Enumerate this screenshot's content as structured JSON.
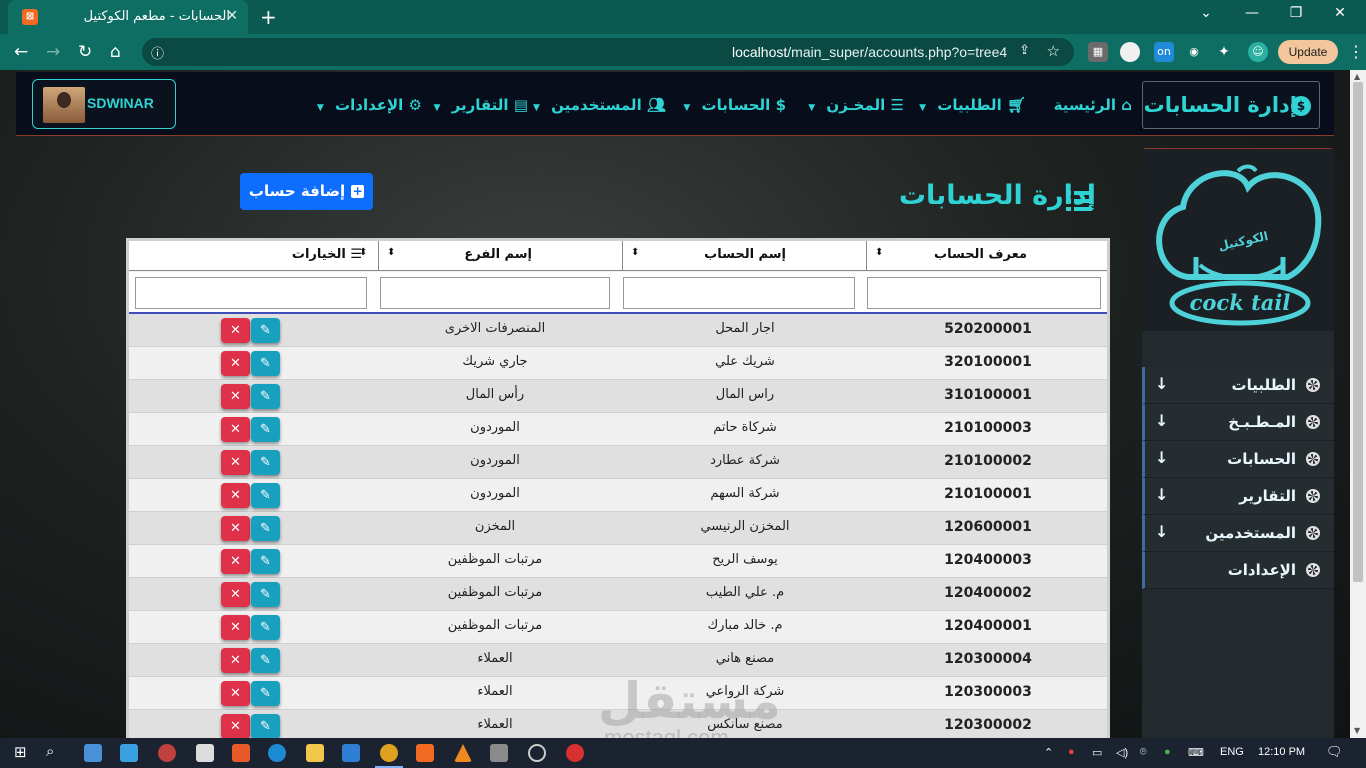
{
  "browser": {
    "tab_title": "الحسابات - مطعم الكوكتيل",
    "tab_close": "✕",
    "new_tab": "+",
    "url_host": "localhost",
    "url_path": "/main_super/accounts.php?o=tree4",
    "update_label": "Update",
    "window_controls": [
      "⌄",
      "—",
      "❐",
      "✕"
    ]
  },
  "navbar": {
    "brand_title": "إدارة الحسابات",
    "brand_icon": "$",
    "items": [
      {
        "label": "الرئيسية",
        "icon": "home-icon",
        "has_caret": false
      },
      {
        "label": "الطلبيات",
        "icon": "cart-icon",
        "has_caret": true
      },
      {
        "label": "المخـزن",
        "icon": "database-icon",
        "has_caret": true
      },
      {
        "label": "الحسابات",
        "icon": "money-icon",
        "has_caret": true
      },
      {
        "label": "المستخدمين",
        "icon": "users-icon",
        "has_caret": true
      },
      {
        "label": "التقارير",
        "icon": "chart-icon",
        "has_caret": true
      },
      {
        "label": "الإعدادات",
        "icon": "gear-icon",
        "has_caret": true
      }
    ],
    "username": "SDWINAR"
  },
  "sidebar": {
    "logo_text": "cock tail",
    "logo_arabic": "الكوكتيل",
    "items": [
      {
        "label": "الطلبيات",
        "has_arrow": true
      },
      {
        "label": "المـطـبـخ",
        "has_arrow": true
      },
      {
        "label": "الحسابات",
        "has_arrow": true
      },
      {
        "label": "التقارير",
        "has_arrow": true
      },
      {
        "label": "المستخدمين",
        "has_arrow": true
      },
      {
        "label": "الإعدادات",
        "has_arrow": false
      }
    ]
  },
  "main": {
    "page_title": "إدارة الحسابات",
    "add_button": "إضافة حساب",
    "table": {
      "headers": [
        "معرف الحساب",
        "إسم الحساب",
        "إسم الفرع",
        "الخيارات"
      ],
      "rows": [
        {
          "id": "520200001",
          "name": "اجار المحل",
          "branch": "المنصرفات الاخرى"
        },
        {
          "id": "320100001",
          "name": "شريك علي",
          "branch": "جاري شريك"
        },
        {
          "id": "310100001",
          "name": "راس المال",
          "branch": "رأس المال"
        },
        {
          "id": "210100003",
          "name": "شركاة حاتم",
          "branch": "الموردون"
        },
        {
          "id": "210100002",
          "name": "شركة عطارد",
          "branch": "الموردون"
        },
        {
          "id": "210100001",
          "name": "شركة السهم",
          "branch": "الموردون"
        },
        {
          "id": "120600001",
          "name": "المخزن الرنيسي",
          "branch": "المخزن"
        },
        {
          "id": "120400003",
          "name": "يوسف الريح",
          "branch": "مرتبات الموظفين"
        },
        {
          "id": "120400002",
          "name": "م. علي الطيب",
          "branch": "مرتبات الموظفين"
        },
        {
          "id": "120400001",
          "name": "م. خالد مبارك",
          "branch": "مرتبات الموظفين"
        },
        {
          "id": "120300004",
          "name": "مصنع هاني",
          "branch": "العملاء"
        },
        {
          "id": "120300003",
          "name": "شركة الرواعي",
          "branch": "العملاء"
        },
        {
          "id": "120300002",
          "name": "مصنع سانكس",
          "branch": "العملاء"
        }
      ]
    }
  },
  "watermark": {
    "arabic": "مستقل",
    "latin": "mostaql.com"
  },
  "taskbar": {
    "language": "ENG",
    "time": "12:10 PM"
  },
  "colors": {
    "accent": "#2fd3d3",
    "primary_button": "#0d6efd",
    "delete": "#e0314a",
    "edit": "#1aa0bf",
    "navbar_bg": "#070d1a",
    "tab_bar": "#0b5a52"
  }
}
